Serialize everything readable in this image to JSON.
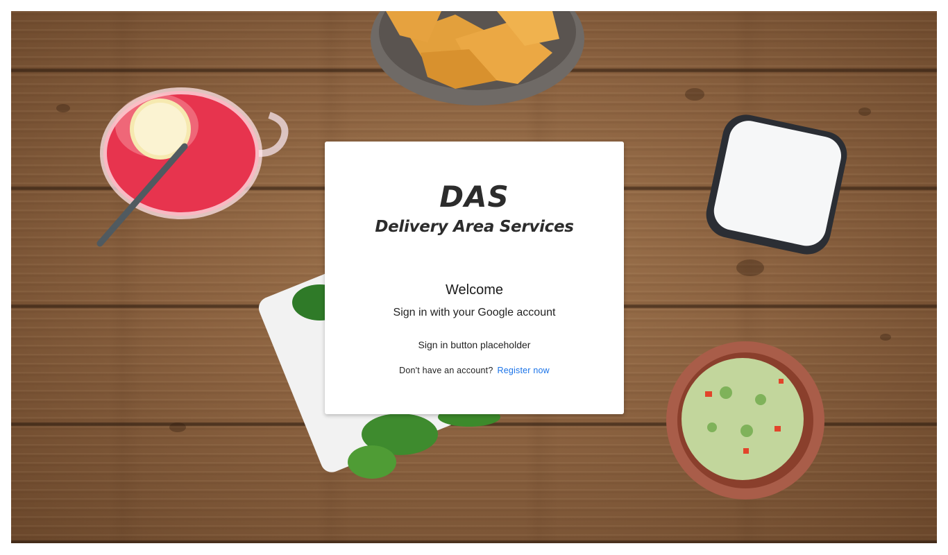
{
  "brand": {
    "logo_main": "DAS",
    "logo_sub": "Delivery Area Services"
  },
  "login": {
    "welcome": "Welcome",
    "subtitle": "Sign in with your Google account",
    "signin_placeholder": "Sign in button placeholder",
    "no_account_text": "Don't have an account?",
    "register_link": "Register now"
  },
  "colors": {
    "link": "#1a73e8",
    "card_background": "#ffffff",
    "logo_text": "#2c2c2c"
  }
}
